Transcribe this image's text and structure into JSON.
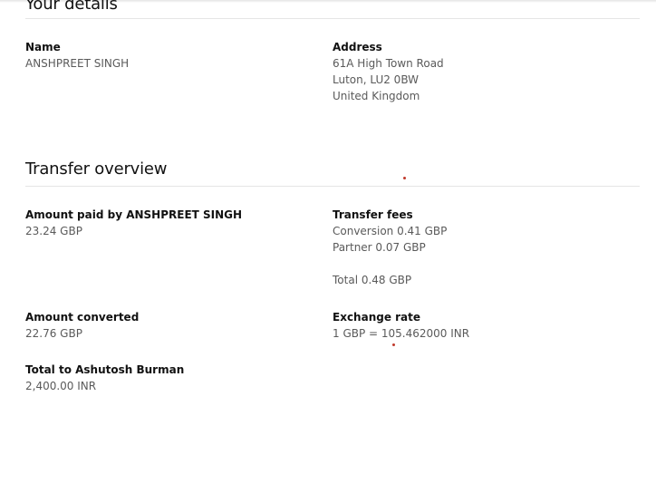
{
  "your_details": {
    "title": "Your details",
    "name_label": "Name",
    "name_value": "ANSHPREET SINGH",
    "address_label": "Address",
    "address_line1": "61A High Town Road",
    "address_line2": "Luton, LU2 0BW",
    "address_line3": "United Kingdom"
  },
  "transfer_overview": {
    "title": "Transfer overview",
    "amount_paid_label": "Amount paid by ANSHPREET SINGH",
    "amount_paid_value": "23.24 GBP",
    "fees_label": "Transfer fees",
    "fee_conversion": "Conversion 0.41 GBP",
    "fee_partner": "Partner 0.07 GBP",
    "fee_total": "Total 0.48 GBP",
    "amount_converted_label": "Amount converted",
    "amount_converted_value": "22.76 GBP",
    "exchange_rate_label": "Exchange rate",
    "exchange_rate_value": "1 GBP = 105.462000 INR",
    "total_to_label": "Total to Ashutosh Burman",
    "total_to_value": "2,400.00 INR"
  }
}
